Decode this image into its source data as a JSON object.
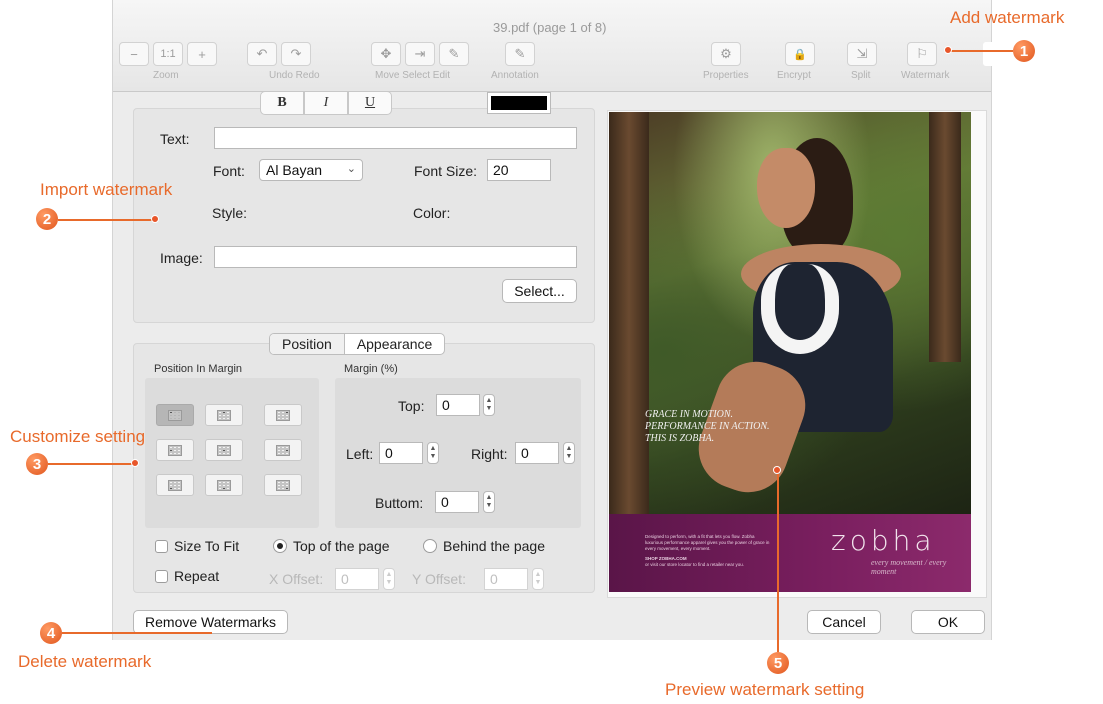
{
  "window": {
    "title": "39.pdf (page 1 of 8)"
  },
  "toolbar": {
    "labels": {
      "zoom": "Zoom",
      "undo_redo": "Undo Redo",
      "move_select_edit": "Move Select Edit",
      "annotation": "Annotation",
      "properties": "Properties",
      "encrypt": "Encrypt",
      "split": "Split",
      "watermark": "Watermark"
    },
    "icons": {
      "zoom_out": "−",
      "actual_size": "1:1",
      "zoom_in": "+",
      "undo": "↶",
      "redo": "↷",
      "move": "✥",
      "select": "⇥",
      "edit": "✎",
      "annotation": "✎",
      "properties": "⚙",
      "encrypt": "🔒",
      "split": "⇲",
      "watermark": "⚐"
    }
  },
  "text_section": {
    "text_label": "Text:",
    "text_value": "",
    "font_label": "Font:",
    "font_value": "Al Bayan",
    "font_size_label": "Font Size:",
    "font_size_value": "20",
    "style_label": "Style:",
    "bold": "B",
    "italic": "I",
    "underline": "U",
    "color_label": "Color:",
    "color_value": "#000000",
    "image_label": "Image:",
    "image_value": "",
    "select_button": "Select..."
  },
  "tabs": {
    "position": "Position",
    "appearance": "Appearance",
    "selected": "Position"
  },
  "position_section": {
    "position_in_margin_label": "Position In Margin",
    "selected_cell": 1,
    "margin_label": "Margin (%)",
    "top_label": "Top:",
    "top_value": "0",
    "left_label": "Left:",
    "left_value": "0",
    "right_label": "Right:",
    "right_value": "0",
    "bottom_label": "Buttom:",
    "bottom_value": "0"
  },
  "options": {
    "size_to_fit": "Size To Fit",
    "size_to_fit_checked": false,
    "top_of_page": "Top of the page",
    "top_of_page_selected": true,
    "behind_page": "Behind the page",
    "behind_page_selected": false,
    "repeat": "Repeat",
    "repeat_checked": false,
    "x_offset_label": "X Offset:",
    "x_offset_value": "0",
    "y_offset_label": "Y Offset:",
    "y_offset_value": "0"
  },
  "buttons": {
    "remove": "Remove Watermarks",
    "cancel": "Cancel",
    "ok": "OK"
  },
  "preview": {
    "tagline": [
      "GRACE IN MOTION.",
      "PERFORMANCE IN ACTION.",
      "THIS IS ZOBHA."
    ],
    "band_copy": "Designed to perform, with a fit that lets you flow. Zobha luxurious performance apparel gives you the power of grace in every movement, every moment.",
    "shop": "SHOP ZOBHA.COM",
    "shop_sub": "or visit our store locator to find a retailer near you.",
    "brand": "zobha",
    "brand_sub": "every movement / every moment"
  },
  "callouts": {
    "c1": {
      "number": "1",
      "text": "Add watermark"
    },
    "c2": {
      "number": "2",
      "text": "Import watermark"
    },
    "c3": {
      "number": "3",
      "text": "Customize setting"
    },
    "c4": {
      "number": "4",
      "text": "Delete watermark"
    },
    "c5": {
      "number": "5",
      "text": "Preview watermark setting"
    }
  },
  "colors": {
    "accent": "#e86a2b",
    "window_bg": "#ececec",
    "brand_band": "#7a1f5f"
  }
}
